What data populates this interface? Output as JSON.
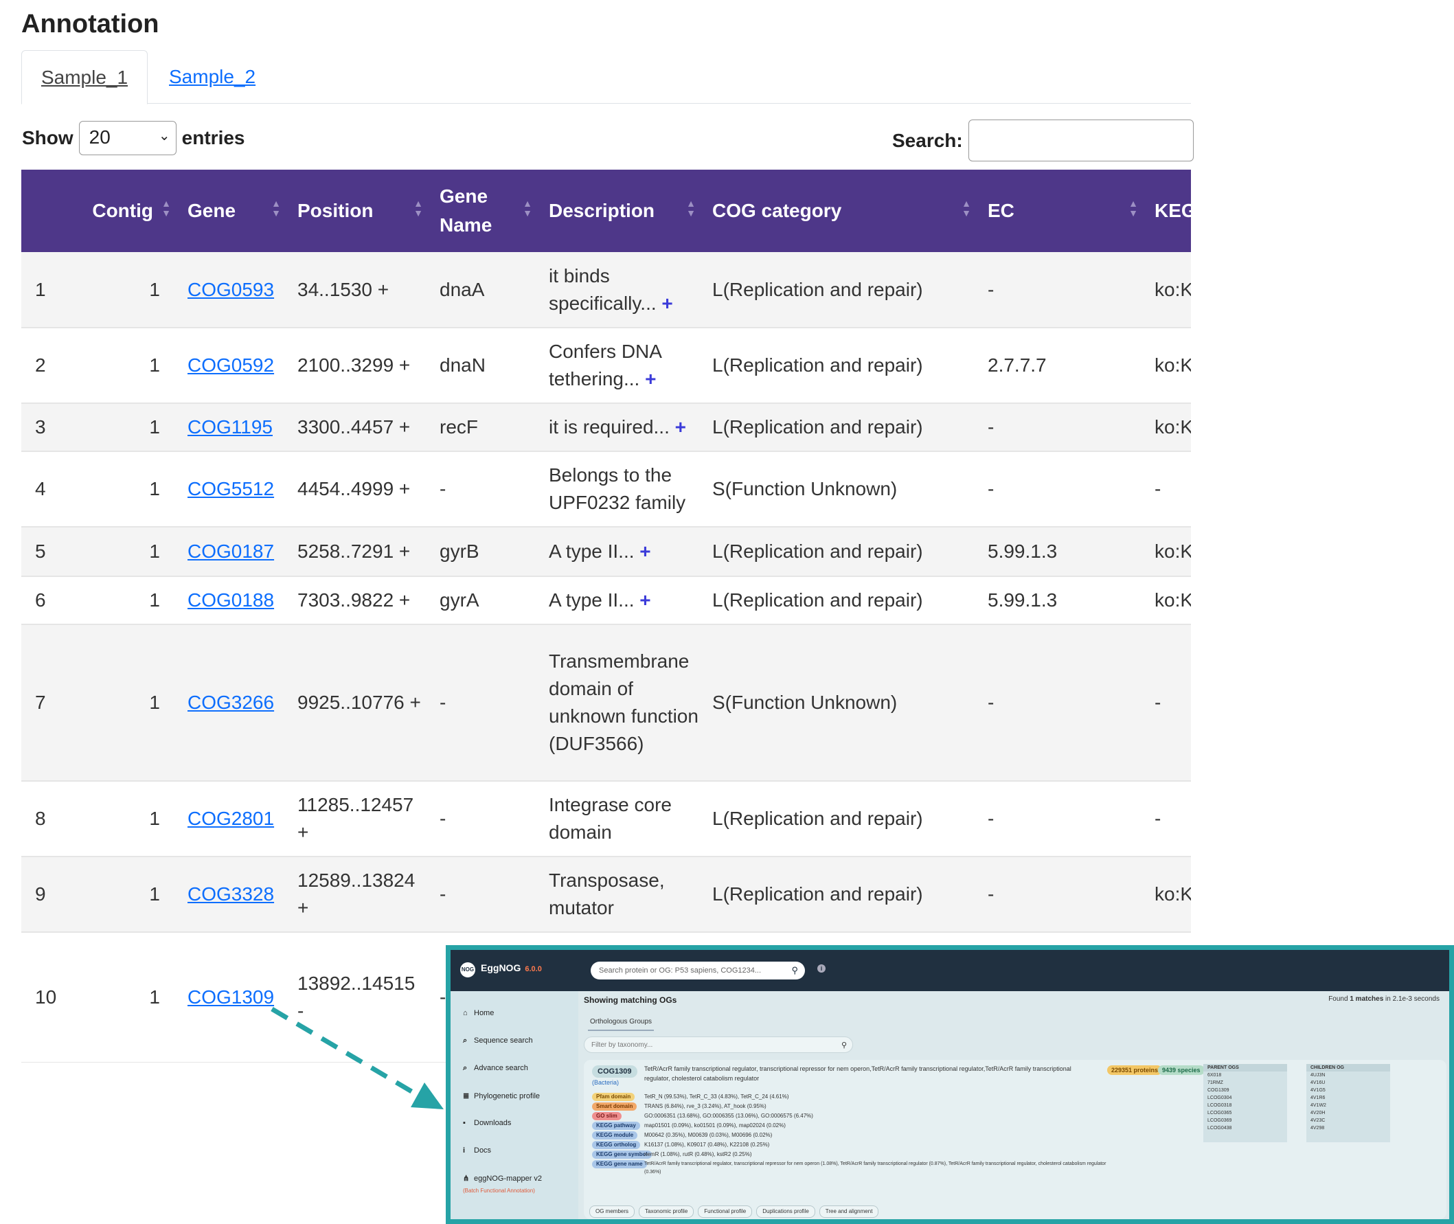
{
  "page": {
    "title": "Annotation"
  },
  "tabs": [
    {
      "label": "Sample_1"
    },
    {
      "label": "Sample_2"
    }
  ],
  "controls": {
    "show_label": "Show",
    "entries_label": "entries",
    "length_value": "20",
    "search_label": "Search:",
    "search_value": ""
  },
  "table": {
    "columns": [
      "",
      "Contig",
      "Gene",
      "Position",
      "Gene Name",
      "Description",
      "COG category",
      "EC",
      "KEG"
    ],
    "rows": [
      {
        "num": "1",
        "contig": "1",
        "gene": "COG0593",
        "position": "34..1530 +",
        "name": "dnaA",
        "desc": "it binds specifically...",
        "desc_more": "+",
        "cog": "L(Replication and repair)",
        "ec": "-",
        "kegg": "ko:K"
      },
      {
        "num": "2",
        "contig": "1",
        "gene": "COG0592",
        "position": "2100..3299 +",
        "name": "dnaN",
        "desc": "Confers DNA tethering...",
        "desc_more": "+",
        "cog": "L(Replication and repair)",
        "ec": "2.7.7.7",
        "kegg": "ko:K"
      },
      {
        "num": "3",
        "contig": "1",
        "gene": "COG1195",
        "position": "3300..4457 +",
        "name": "recF",
        "desc": "it is required...",
        "desc_more": "+",
        "cog": "L(Replication and repair)",
        "ec": "-",
        "kegg": "ko:K"
      },
      {
        "num": "4",
        "contig": "1",
        "gene": "COG5512",
        "position": "4454..4999 +",
        "name": "-",
        "desc": "Belongs to the UPF0232 family",
        "desc_more": "",
        "cog": "S(Function Unknown)",
        "ec": "-",
        "kegg": "-"
      },
      {
        "num": "5",
        "contig": "1",
        "gene": "COG0187",
        "position": "5258..7291 +",
        "name": "gyrB",
        "desc": "A type II...",
        "desc_more": "+",
        "cog": "L(Replication and repair)",
        "ec": "5.99.1.3",
        "kegg": "ko:K"
      },
      {
        "num": "6",
        "contig": "1",
        "gene": "COG0188",
        "position": "7303..9822 +",
        "name": "gyrA",
        "desc": "A type II...",
        "desc_more": "+",
        "cog": "L(Replication and repair)",
        "ec": "5.99.1.3",
        "kegg": "ko:K"
      },
      {
        "num": "7",
        "contig": "1",
        "gene": "COG3266",
        "position": "9925..10776 +",
        "name": "-",
        "desc": "Transmembrane domain of unknown function (DUF3566)",
        "desc_more": "",
        "cog": "S(Function Unknown)",
        "ec": "-",
        "kegg": "-"
      },
      {
        "num": "8",
        "contig": "1",
        "gene": "COG2801",
        "position": "11285..12457 +",
        "name": "-",
        "desc": "Integrase core domain",
        "desc_more": "",
        "cog": "L(Replication and repair)",
        "ec": "-",
        "kegg": "-"
      },
      {
        "num": "9",
        "contig": "1",
        "gene": "COG3328",
        "position": "12589..13824 +",
        "name": "-",
        "desc": "Transposase, mutator",
        "desc_more": "",
        "cog": "L(Replication and repair)",
        "ec": "-",
        "kegg": "ko:K"
      },
      {
        "num": "10",
        "contig": "1",
        "gene": "COG1309",
        "position": "13892..14515 -",
        "name": "-",
        "desc": "",
        "desc_more": "",
        "cog": "",
        "ec": "",
        "kegg": ""
      }
    ]
  },
  "inset": {
    "logo_text": "NOG",
    "brand": "EggNOG",
    "version": "6.0.0",
    "search_placeholder": "Search protein or OG: P53 sapiens, COG1234...",
    "sidebar": [
      {
        "icon": "⌂",
        "label": "Home"
      },
      {
        "icon": "⌕",
        "label": "Sequence search"
      },
      {
        "icon": "⌕",
        "label": "Advance search"
      },
      {
        "icon": "≣",
        "label": "Phylogenetic profile"
      },
      {
        "icon": "▪",
        "label": "Downloads"
      },
      {
        "icon": "i",
        "label": "Docs"
      },
      {
        "icon": "⋔",
        "label": "eggNOG-mapper v2"
      }
    ],
    "sidebar_sub": "(Batch Functional Annotation)",
    "content_title": "Showing matching OGs",
    "found_prefix": "Found",
    "found_count": "1 matches",
    "found_suffix": "in 2.1e-3 seconds",
    "og_tab": "Orthologous Groups",
    "filter_placeholder": "Filter by taxonomy...",
    "og_id": "COG1309",
    "og_taxon": "(Bacteria)",
    "og_description": "TetR/AcrR family transcriptional regulator, transcriptional repressor for nem operon,TetR/AcrR family transcriptional regulator,TetR/AcrR family transcriptional regulator, cholesterol catabolism regulator",
    "proteins_badge": "229351 proteins",
    "species_badge": "9439 species",
    "attributes": [
      {
        "label": "Pfam domain",
        "value": "TetR_N (99.53%),  TetR_C_33 (4.83%),  TetR_C_24 (4.61%)"
      },
      {
        "label": "Smart domain",
        "value": "TRANS (6.84%),  rve_3 (3.24%),  AT_hook (0.95%)"
      },
      {
        "label": "GO slim",
        "value": "GO:0006351 (13.68%),  GO:0006355 (13.06%),  GO:0006575 (6.47%)"
      },
      {
        "label": "KEGG pathway",
        "value": "map01501 (0.09%),  ko01501 (0.09%),  map02024 (0.02%)"
      },
      {
        "label": "KEGG module",
        "value": "M00642 (0.35%),  M00639 (0.03%),  M00696 (0.02%)"
      },
      {
        "label": "KEGG ortholog",
        "value": "K16137 (1.08%),  K09017 (0.48%),  K22108 (0.25%)"
      },
      {
        "label": "KEGG gene symbol",
        "value": "nemR (1.08%),  rutR (0.48%),  kstR2 (0.25%)"
      },
      {
        "label": "KEGG gene name",
        "value": "TetR/AcrR family transcriptional regulator, transcriptional repressor for nem operon (1.08%),  TetR/AcrR family transcriptional regulator (0.87%),  TetR/AcrR family transcriptional regulator, cholesterol catabolism regulator"
      },
      {
        "label": "",
        "value": "(0.36%)"
      }
    ],
    "parent_header": "PARENT OGS",
    "parent_ogs": [
      "6X018",
      "71RMZ",
      "COG1309",
      "LCOG0304",
      "LCOG0318",
      "LCOG0365",
      "LCOG0369",
      "LCOG0438"
    ],
    "children_header": "CHILDREN OG",
    "children_ogs": [
      "4UJ3N",
      "4V16U",
      "4V1G5",
      "4V1R6",
      "4V1W2",
      "4V20H",
      "4V23C",
      "4V298"
    ],
    "bottom_tabs": [
      "OG members",
      "Taxonomic profile",
      "Functional profile",
      "Duplications profile",
      "Tree and alignment"
    ]
  },
  "colors": {
    "header_purple": "#4e3789",
    "link_blue": "#0d6efd",
    "inset_border": "#26a3a6",
    "inset_topbar": "#203040",
    "arrow": "#26a3a6"
  }
}
